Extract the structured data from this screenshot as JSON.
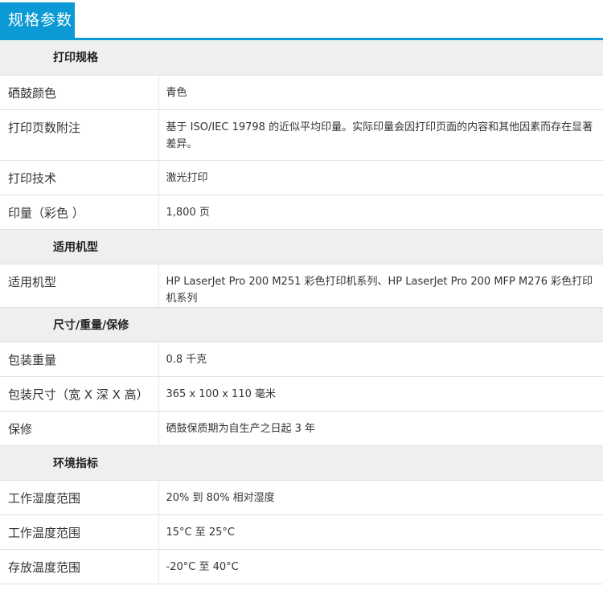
{
  "header": {
    "title": "规格参数"
  },
  "sections": [
    {
      "title": "打印规格",
      "rows": [
        {
          "label": "硒鼓颜色",
          "value": "青色"
        },
        {
          "label": "打印页数附注",
          "value": "基于 ISO/IEC 19798 的近似平均印量。实际印量会因打印页面的内容和其他因素而存在显著差异。"
        },
        {
          "label": "打印技术",
          "value": "激光打印"
        },
        {
          "label": "印量（彩色 ）",
          "value": "1,800 页"
        }
      ]
    },
    {
      "title": "适用机型",
      "rows": [
        {
          "label": "适用机型",
          "value": "HP LaserJet Pro 200 M251 彩色打印机系列、HP LaserJet Pro 200 MFP M276 彩色打印机系列"
        }
      ]
    },
    {
      "title": "尺寸/重量/保修",
      "rows": [
        {
          "label": "包装重量",
          "value": "0.8 千克"
        },
        {
          "label": "包装尺寸（宽 X 深 X 高）",
          "value": "365 x 100 x 110 毫米"
        },
        {
          "label": "保修",
          "value": "硒鼓保质期为自生产之日起 3 年"
        }
      ]
    },
    {
      "title": "环境指标",
      "rows": [
        {
          "label": "工作湿度范围",
          "value": "20% 到 80% 相对湿度"
        },
        {
          "label": "工作温度范围",
          "value": "15°C 至 25°C"
        },
        {
          "label": "存放温度范围",
          "value": "-20°C 至 40°C"
        }
      ]
    }
  ]
}
